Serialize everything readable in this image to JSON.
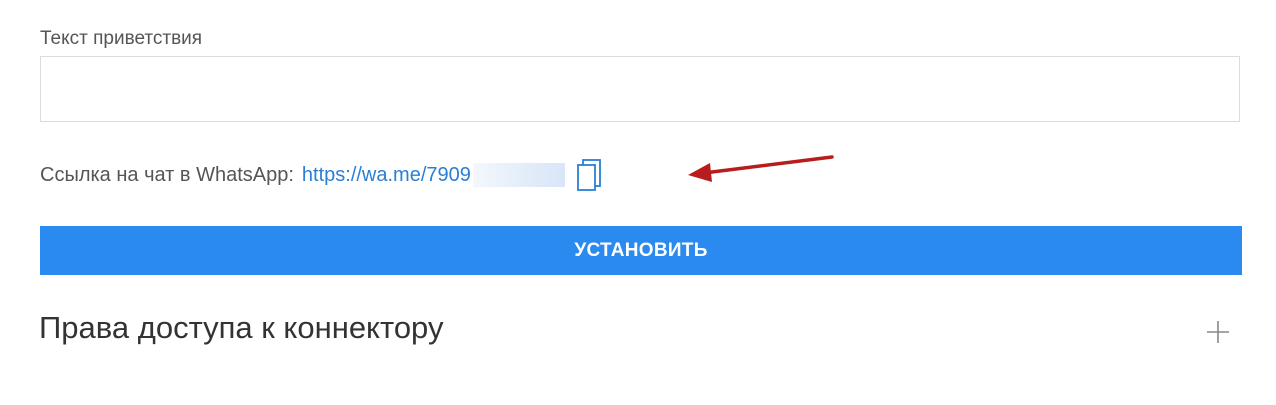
{
  "greeting": {
    "label": "Текст приветствия",
    "value": "",
    "placeholder": ""
  },
  "whatsapp": {
    "label": "Ссылка на чат в WhatsApp:",
    "link_text": "https://wa.me/7909",
    "redacted": true,
    "copy_icon": "copy-icon"
  },
  "install_button": {
    "label": "УСТАНОВИТЬ"
  },
  "access_section": {
    "title": "Права доступа к коннектору",
    "expand_icon": "plus-icon"
  },
  "colors": {
    "button_bg": "#2a8af0",
    "link": "#2a7fd4",
    "annotation_arrow": "#b81c1c"
  }
}
